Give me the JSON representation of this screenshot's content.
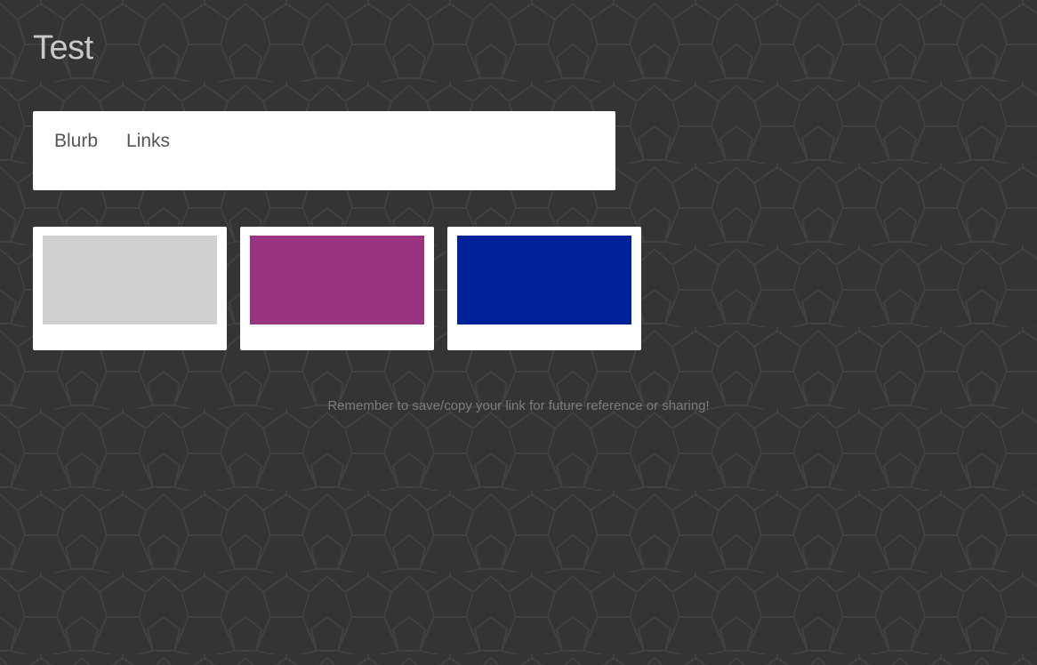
{
  "page": {
    "title": "Test",
    "background_color": "#343434",
    "pattern_color": "#414141"
  },
  "tabs": [
    {
      "label": "Blurb"
    },
    {
      "label": "Links"
    }
  ],
  "swatches": [
    {
      "color": "#d0d0d0"
    },
    {
      "color": "#993382"
    },
    {
      "color": "#002299"
    }
  ],
  "footer": {
    "note": "Remember to save/copy your link for future reference or sharing!"
  }
}
